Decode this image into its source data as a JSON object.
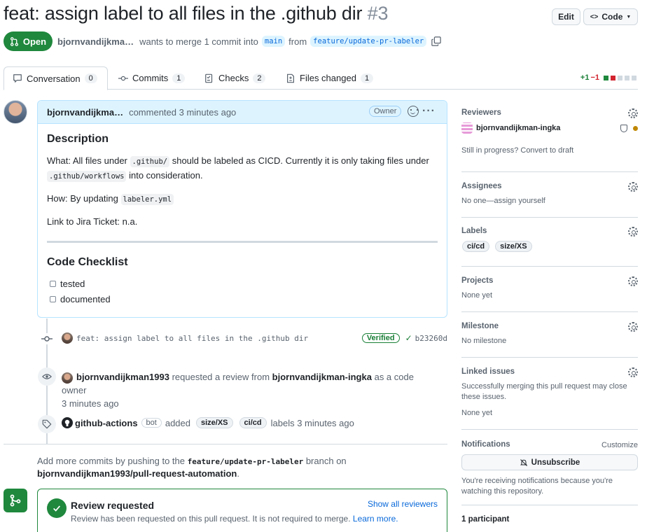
{
  "header": {
    "title": "feat: assign label to all files in the .github dir",
    "number": "#3",
    "edit_label": "Edit",
    "code_label": "Code"
  },
  "state": {
    "label": "Open",
    "author": "bjornvandijkma…",
    "text1": "wants to merge 1 commit into",
    "base": "main",
    "text2": "from",
    "head": "feature/update-pr-labeler"
  },
  "tabs": [
    {
      "label": "Conversation",
      "count": "0"
    },
    {
      "label": "Commits",
      "count": "1"
    },
    {
      "label": "Checks",
      "count": "2"
    },
    {
      "label": "Files changed",
      "count": "1"
    }
  ],
  "diffstat": {
    "add": "+1",
    "del": "−1"
  },
  "comment": {
    "author": "bjornvandijkma…",
    "action": "commented 3 minutes ago",
    "badge": "Owner",
    "h_description": "Description",
    "what_pre": "What: All files under",
    "what_code1": ".github/",
    "what_mid": "should be labeled as CICD. Currently it is only taking files under",
    "what_code2": ".github/workflows",
    "what_post": "into consideration.",
    "how_pre": "How: By updating",
    "how_code": "labeler.yml",
    "jira": "Link to Jira Ticket: n.a.",
    "h_checklist": "Code Checklist",
    "check1": "tested",
    "check2": "documented"
  },
  "timeline": {
    "commit_msg": "feat: assign label to all files in the .github dir",
    "verified": "Verified",
    "sha": "b23260d",
    "review_actor": "bjornvandijkman1993",
    "review_text": "requested a review from",
    "review_target": "bjornvandijkman-ingka",
    "review_post": "as a code owner",
    "review_time": "3 minutes ago",
    "label_actor": "github-actions",
    "bot": "bot",
    "label_added": "added",
    "label1": "size/XS",
    "label2": "ci/cd",
    "label_time": "labels 3 minutes ago"
  },
  "push": {
    "pre": "Add more commits by pushing to the",
    "branch": "feature/update-pr-labeler",
    "mid": "branch on",
    "repo": "bjornvandijkman1993/pull-request-automation",
    "post": "."
  },
  "review_box": {
    "title": "Review requested",
    "text": "Review has been requested on this pull request. It is not required to merge.",
    "learn": "Learn more.",
    "show_all": "Show all reviewers"
  },
  "sidebar": {
    "reviewers_h": "Reviewers",
    "reviewer": "bjornvandijkman-ingka",
    "draft": "Still in progress? Convert to draft",
    "assignees_h": "Assignees",
    "assignees": "No one—assign yourself",
    "labels_h": "Labels",
    "label1": "ci/cd",
    "label2": "size/XS",
    "projects_h": "Projects",
    "projects": "None yet",
    "milestone_h": "Milestone",
    "milestone": "No milestone",
    "linked_h": "Linked issues",
    "linked_text": "Successfully merging this pull request may close these issues.",
    "linked_none": "None yet",
    "notif_h": "Notifications",
    "customize": "Customize",
    "unsubscribe": "Unsubscribe",
    "notif_text": "You're receiving notifications because you're watching this repository.",
    "participants": "1 participant"
  }
}
